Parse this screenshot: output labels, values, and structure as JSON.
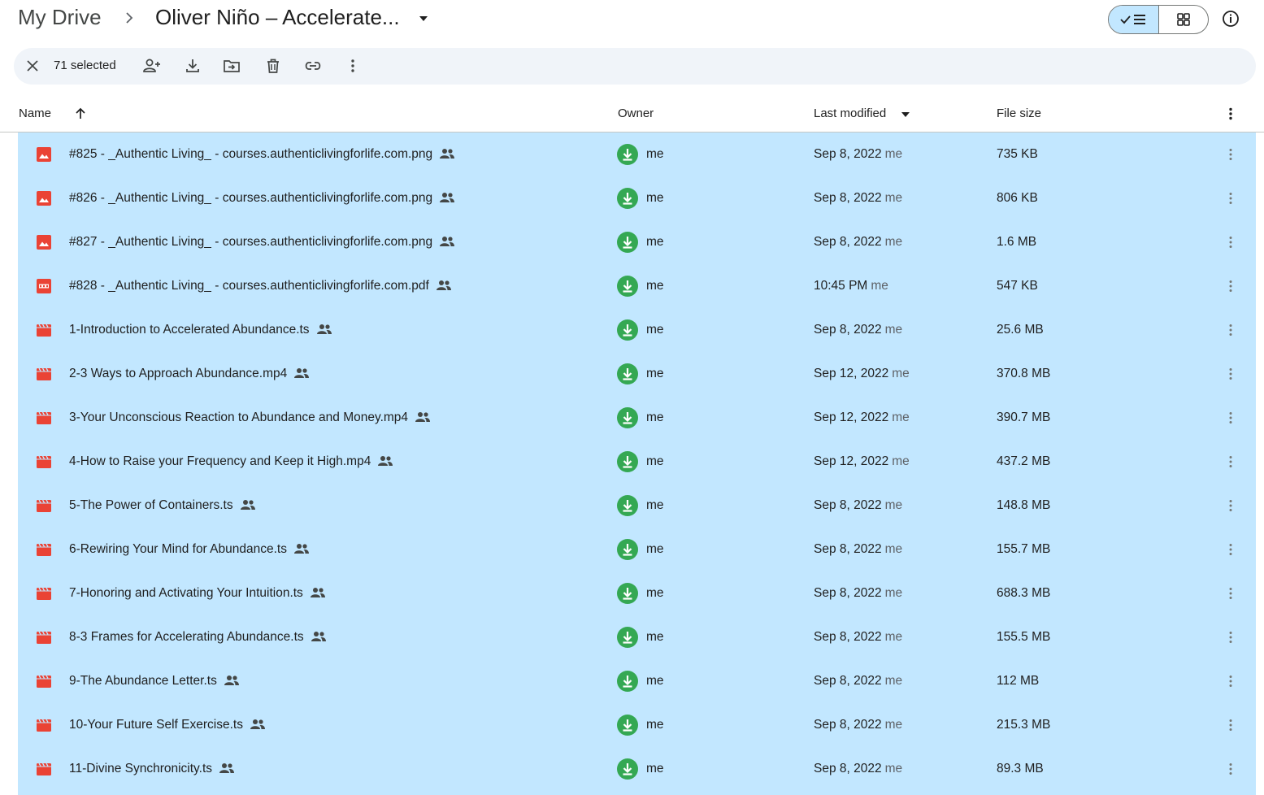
{
  "breadcrumb": {
    "root": "My Drive",
    "current": "Oliver Niño – Accelerate..."
  },
  "toolbar": {
    "selected_count": "71 selected",
    "icons": [
      "close-icon",
      "share-person-add-icon",
      "download-icon",
      "move-to-folder-icon",
      "trash-icon",
      "link-icon",
      "more-vert-icon"
    ]
  },
  "view": {
    "mode": "list"
  },
  "columns": {
    "name": "Name",
    "owner": "Owner",
    "last_modified": "Last modified",
    "file_size": "File size",
    "sort": "name-ascending"
  },
  "colors": {
    "selection": "#c2e7ff",
    "file_icon_red": "#ea4335",
    "owner_green": "#34a853",
    "toolbar_bg": "#f0f4f9"
  },
  "files": [
    {
      "type": "image",
      "name": "#825 - _Authentic Living_ - courses.authenticlivingforlife.com.png",
      "owner": "me",
      "modified": "Sep 8, 2022",
      "modified_by": "me",
      "size": "735 KB"
    },
    {
      "type": "image",
      "name": "#826 - _Authentic Living_ - courses.authenticlivingforlife.com.png",
      "owner": "me",
      "modified": "Sep 8, 2022",
      "modified_by": "me",
      "size": "806 KB"
    },
    {
      "type": "image",
      "name": "#827 - _Authentic Living_ - courses.authenticlivingforlife.com.png",
      "owner": "me",
      "modified": "Sep 8, 2022",
      "modified_by": "me",
      "size": "1.6 MB"
    },
    {
      "type": "pdf",
      "name": "#828 - _Authentic Living_ - courses.authenticlivingforlife.com.pdf",
      "owner": "me",
      "modified": "10:45 PM",
      "modified_by": "me",
      "size": "547 KB"
    },
    {
      "type": "video",
      "name": "1-Introduction to Accelerated Abundance.ts",
      "owner": "me",
      "modified": "Sep 8, 2022",
      "modified_by": "me",
      "size": "25.6 MB"
    },
    {
      "type": "video",
      "name": "2-3 Ways to Approach Abundance.mp4",
      "owner": "me",
      "modified": "Sep 12, 2022",
      "modified_by": "me",
      "size": "370.8 MB"
    },
    {
      "type": "video",
      "name": "3-Your Unconscious Reaction to Abundance and Money.mp4",
      "owner": "me",
      "modified": "Sep 12, 2022",
      "modified_by": "me",
      "size": "390.7 MB"
    },
    {
      "type": "video",
      "name": "4-How to Raise your Frequency and Keep it High.mp4",
      "owner": "me",
      "modified": "Sep 12, 2022",
      "modified_by": "me",
      "size": "437.2 MB"
    },
    {
      "type": "video",
      "name": "5-The Power of Containers.ts",
      "owner": "me",
      "modified": "Sep 8, 2022",
      "modified_by": "me",
      "size": "148.8 MB"
    },
    {
      "type": "video",
      "name": "6-Rewiring Your Mind for Abundance.ts",
      "owner": "me",
      "modified": "Sep 8, 2022",
      "modified_by": "me",
      "size": "155.7 MB"
    },
    {
      "type": "video",
      "name": "7-Honoring and Activating Your Intuition.ts",
      "owner": "me",
      "modified": "Sep 8, 2022",
      "modified_by": "me",
      "size": "688.3 MB"
    },
    {
      "type": "video",
      "name": "8-3 Frames for Accelerating Abundance.ts",
      "owner": "me",
      "modified": "Sep 8, 2022",
      "modified_by": "me",
      "size": "155.5 MB"
    },
    {
      "type": "video",
      "name": "9-The Abundance Letter.ts",
      "owner": "me",
      "modified": "Sep 8, 2022",
      "modified_by": "me",
      "size": "112 MB"
    },
    {
      "type": "video",
      "name": "10-Your Future Self Exercise.ts",
      "owner": "me",
      "modified": "Sep 8, 2022",
      "modified_by": "me",
      "size": "215.3 MB"
    },
    {
      "type": "video",
      "name": "11-Divine Synchronicity.ts",
      "owner": "me",
      "modified": "Sep 8, 2022",
      "modified_by": "me",
      "size": "89.3 MB"
    }
  ]
}
